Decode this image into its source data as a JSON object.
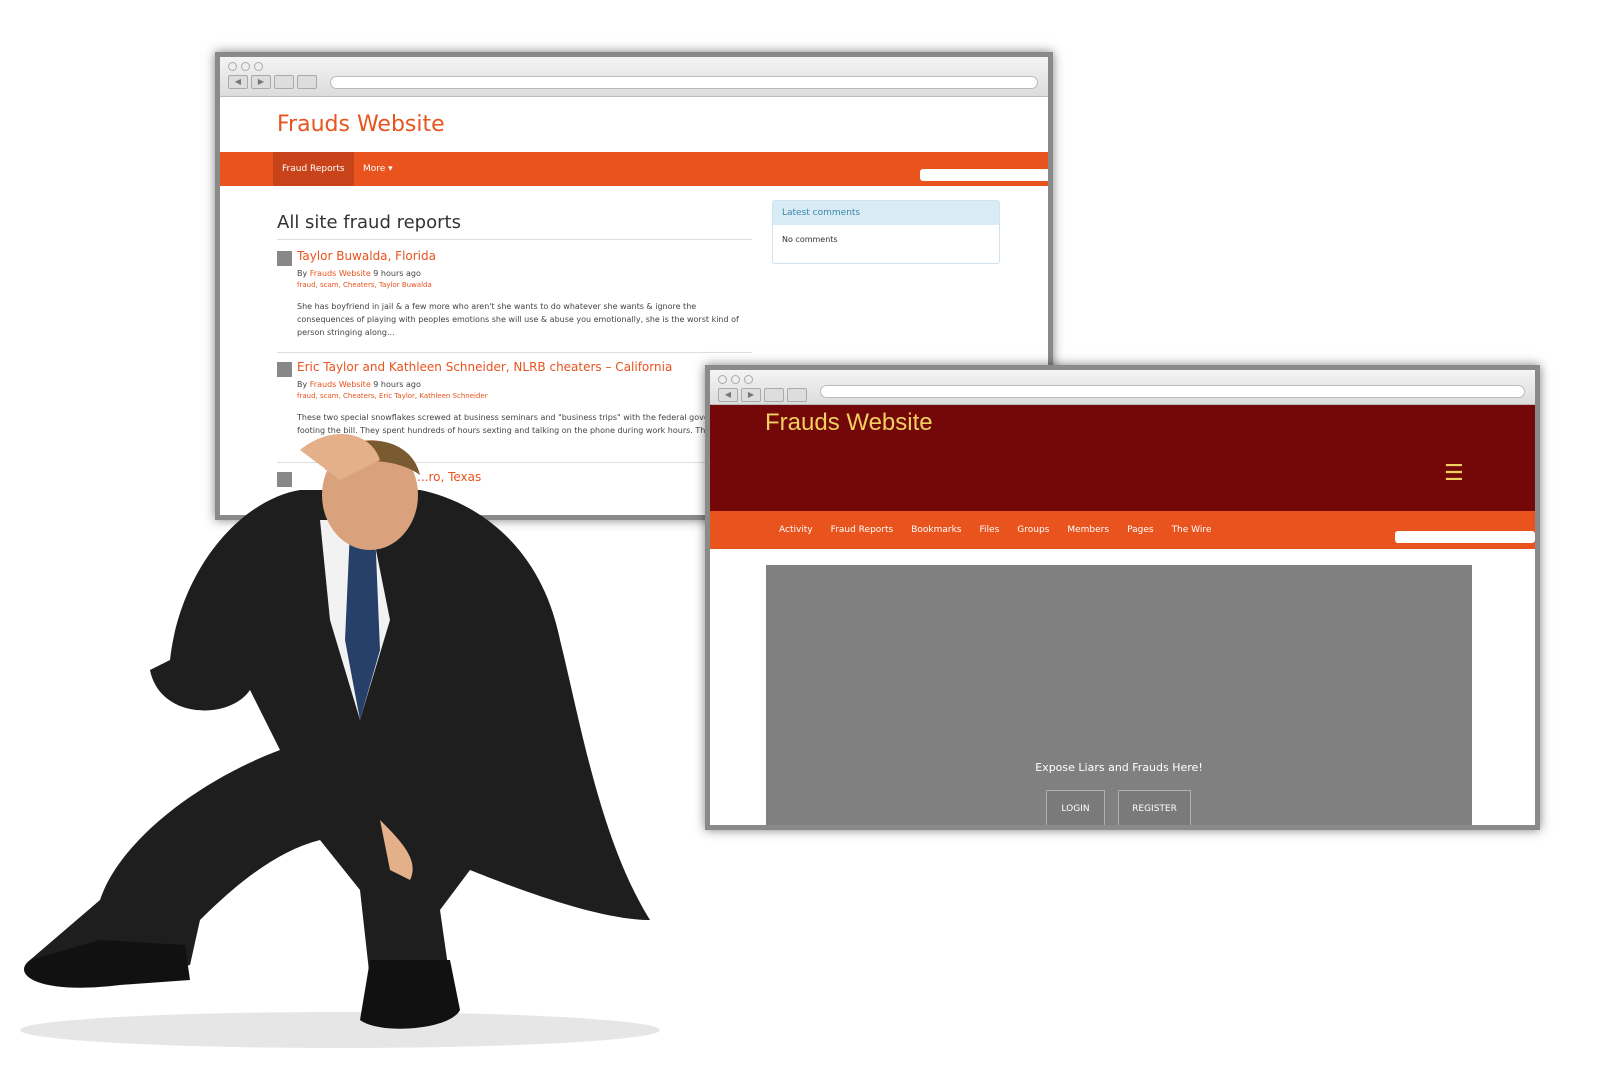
{
  "window1": {
    "site_title": "Frauds Website",
    "nav": [
      "Fraud Reports",
      "More ▾"
    ],
    "heading": "All site fraud reports",
    "posts": [
      {
        "title": "Taylor Buwalda, Florida",
        "by": "By",
        "author": "Frauds Website",
        "time": "9 hours ago",
        "tags": "fraud, scam, Cheaters, Taylor Buwalda",
        "excerpt": "She has boyfriend in jail & a few more who aren't she wants to do whatever she wants & ignore the consequences of playing with peoples emotions she will use & abuse you emotionally, she is the worst kind of person stringing along..."
      },
      {
        "title": "Eric Taylor and Kathleen Schneider, NLRB cheaters – California",
        "by": "By",
        "author": "Frauds Website",
        "time": "9 hours ago",
        "tags": "fraud, scam, Cheaters, Eric Taylor, Kathleen Schneider",
        "excerpt": "These two special snowflakes screwed at business seminars and \"business trips\" with the federal government footing the bill. They spent hundreds of hours sexting and talking on the phone during work hours. They be..."
      },
      {
        "title": "...ro, Texas"
      }
    ],
    "sidebar": {
      "title": "Latest comments",
      "body": "No comments"
    }
  },
  "window2": {
    "site_title": "Frauds Website",
    "menu_icon": "hamburger-icon",
    "nav": [
      "Activity",
      "Fraud Reports",
      "Bookmarks",
      "Files",
      "Groups",
      "Members",
      "Pages",
      "The Wire"
    ],
    "tagline": "Expose Liars and Frauds Here!",
    "login": "LOGIN",
    "register": "REGISTER"
  },
  "colors": {
    "accent": "#e8531e",
    "header": "#740808",
    "title_gold": "#f0d060"
  }
}
